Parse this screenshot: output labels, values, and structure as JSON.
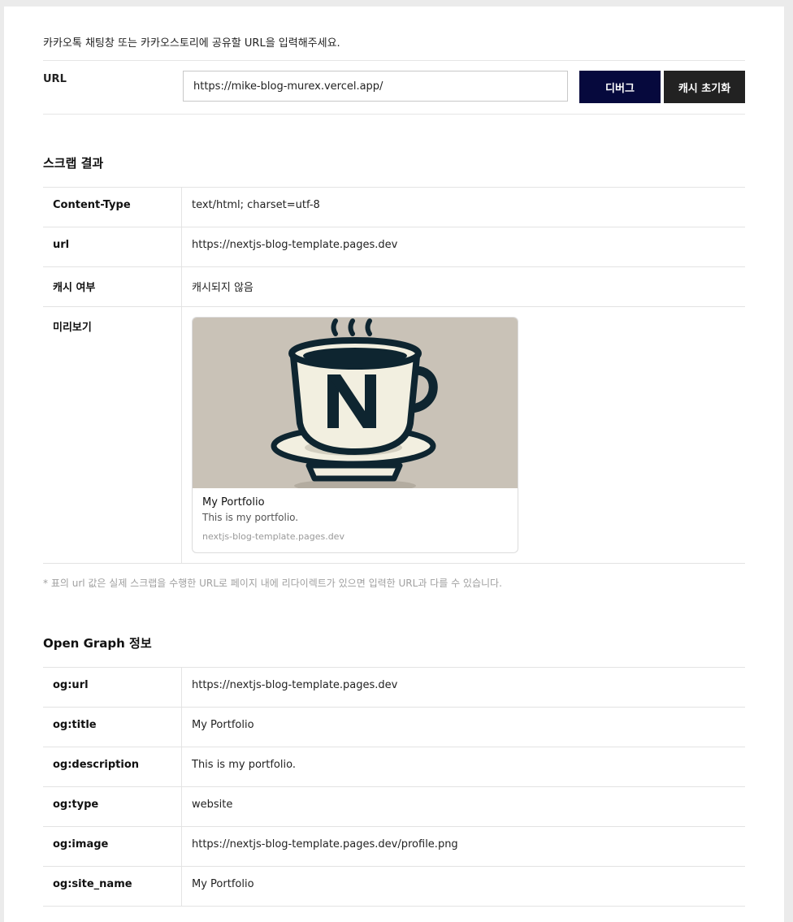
{
  "intro_text": "카카오톡 채팅창 또는 카카오스토리에 공유할 URL을 입력해주세요.",
  "url_form": {
    "label": "URL",
    "value": "https://mike-blog-murex.vercel.app/",
    "debug_button": "디버그",
    "reset_cache_button": "캐시 초기화"
  },
  "scrape": {
    "title": "스크랩 결과",
    "rows": [
      {
        "key": "Content-Type",
        "value": "text/html; charset=utf-8"
      },
      {
        "key": "url",
        "value": "https://nextjs-blog-template.pages.dev"
      },
      {
        "key": "캐시 여부",
        "value": "캐시되지 않음"
      }
    ],
    "preview_label": "미리보기",
    "preview": {
      "title": "My Portfolio",
      "description": "This is my portfolio.",
      "domain": "nextjs-blog-template.pages.dev",
      "image_icon": "coffee-cup-n-logo"
    },
    "note": "* 표의 url 값은 실제 스크랩을 수행한 URL로 페이지 내에 리다이렉트가 있으면 입력한 URL과 다를 수 있습니다."
  },
  "og": {
    "title": "Open Graph 정보",
    "rows": [
      {
        "key": "og:url",
        "value": "https://nextjs-blog-template.pages.dev"
      },
      {
        "key": "og:title",
        "value": "My Portfolio"
      },
      {
        "key": "og:description",
        "value": "This is my portfolio."
      },
      {
        "key": "og:type",
        "value": "website"
      },
      {
        "key": "og:image",
        "value": "https://nextjs-blog-template.pages.dev/profile.png"
      },
      {
        "key": "og:site_name",
        "value": "My Portfolio"
      }
    ]
  },
  "colors": {
    "debug_button": "#06093d",
    "reset_button": "#222222",
    "preview_background": "#c9c2b7"
  }
}
